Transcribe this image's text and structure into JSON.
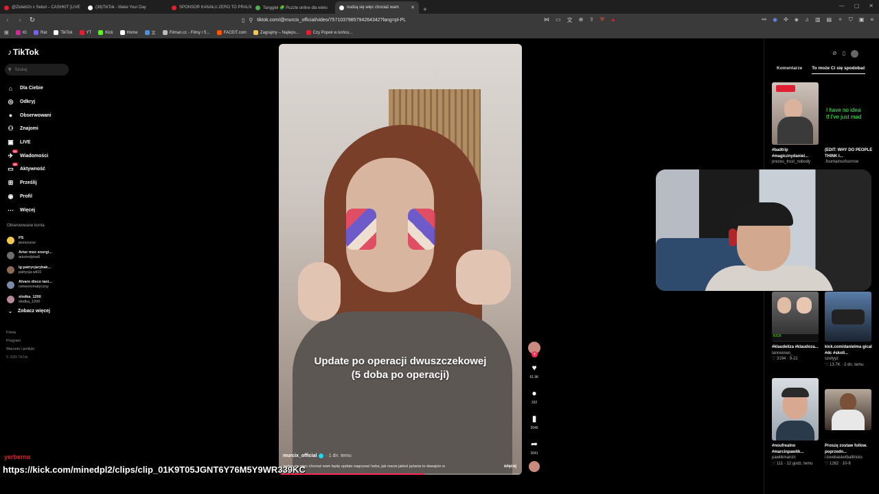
{
  "browser": {
    "tabs": [
      {
        "title": "@Zioleb2n x Sebol – CASHKIT [LIVE",
        "color": "#e02030",
        "active": false
      },
      {
        "title": "(38)TikTok - Make Your Day",
        "color": "#ffffff",
        "active": false
      },
      {
        "title": "SPONSOR KANAŁU ZERO TO PRALN",
        "color": "#e02030",
        "active": false
      },
      {
        "title": "Tangglel 🧩 Puzzle online dla wielu",
        "color": "#4caf50",
        "active": false
      },
      {
        "title": "nudzą się więc chociaż wam",
        "color": "#ffffff",
        "active": true
      }
    ],
    "new_tab": "+",
    "url": "tiktok.com/@murcix_official/video/7571037985794264342?lang=pl-PL",
    "bookmarks": [
      {
        "label": "IG",
        "color": "#d6249f"
      },
      {
        "label": "Rat",
        "color": "#7b5cff"
      },
      {
        "label": "TikTok",
        "color": "#ffffff"
      },
      {
        "label": "YT",
        "color": "#e02030"
      },
      {
        "label": "Kick",
        "color": "#53fc18"
      },
      {
        "label": "Home",
        "color": "#ffffff"
      },
      {
        "label": "文",
        "color": "#4a90e2"
      },
      {
        "label": "Filman.cc - Filmy i S...",
        "color": "#bbbbbb"
      },
      {
        "label": "FACEIT.com",
        "color": "#ff5500"
      },
      {
        "label": "Zagrajmy – Najleps...",
        "color": "#f2c94c"
      },
      {
        "label": "Czy Popek w końcu...",
        "color": "#e02030"
      }
    ]
  },
  "tiktok": {
    "logo": "TikTok",
    "search_placeholder": "Szukaj",
    "nav": [
      {
        "label": "Dla Ciebie",
        "icon": "home-icon",
        "glyph": "⌂"
      },
      {
        "label": "Odkryj",
        "icon": "compass-icon",
        "glyph": "◎"
      },
      {
        "label": "Obserwowani",
        "icon": "avatar-icon",
        "glyph": "●"
      },
      {
        "label": "Znajomi",
        "icon": "friends-icon",
        "glyph": "⚇"
      },
      {
        "label": "LIVE",
        "icon": "live-icon",
        "glyph": "▣"
      },
      {
        "label": "Wiadomości",
        "icon": "messages-icon",
        "glyph": "✈",
        "badge": "34"
      },
      {
        "label": "Aktywność",
        "icon": "activity-icon",
        "glyph": "▭",
        "badge": "10"
      },
      {
        "label": "Prześlij",
        "icon": "upload-icon",
        "glyph": "⊞"
      },
      {
        "label": "Profil",
        "icon": "profile-icon",
        "glyph": "◉"
      },
      {
        "label": "Więcej",
        "icon": "more-icon",
        "glyph": "⋯"
      }
    ],
    "followed_title": "Obserwowane konta",
    "followed": [
      {
        "name": "PS",
        "handle": "pszszszsz",
        "color": "#f2c94c"
      },
      {
        "name": "Artur moc energi...",
        "handle": "arturindykai6",
        "color": "#6d6d6d"
      },
      {
        "name": "ig:patrycjarybak...",
        "handle": "patrycja.wil10",
        "color": "#8a6a5a"
      },
      {
        "name": "Alvaro disco tani...",
        "handle": "romeoromatyczny",
        "color": "#7a8aa8"
      },
      {
        "name": "slodka_1200",
        "handle": "slodka_1200",
        "color": "#b98a9a"
      }
    ],
    "see_more": "Zobacz więcej",
    "footer": [
      "Firma",
      "Program",
      "Warunki i polityki"
    ],
    "copyright": "© 2025 TikTok"
  },
  "video": {
    "caption_line1": "Update po operacji dwuszczekowej",
    "caption_line2": "(5 doba po operacji)",
    "author": "murcix_official",
    "time": "· 1 dn. temu",
    "description": "nudzą się więc chociaż wam będę update nagrywać haha, jak macie jakieś pytania to dawajcie w",
    "more": "więcej",
    "progress": 0.6,
    "likes": "61.9K",
    "comments": "332",
    "saves": "2646",
    "shares": "3041"
  },
  "right_panel": {
    "tabs": [
      "Komentarze",
      "To może Ci się spodobać"
    ],
    "active_tab": 1,
    "cards": [
      {
        "title": "#badtrip #magicznydaniel...",
        "author": "prezes_trust_nobody",
        "stats": ""
      },
      {
        "title": "(EDIT: WHY DO PEOPLE THINK I...",
        "author": ".fountainsofsorrow",
        "stats": ""
      },
      {
        "title": "#klaudeliza #klaudoza...",
        "author": "lanneiowo_",
        "stats": "♡ 3194 · 9-22"
      },
      {
        "title": "kick.com/danielma gical #dc #skoll...",
        "author": "szotyyz",
        "stats": "♡ 13.7K · 2 dn. temu"
      },
      {
        "title": "#noufrealno #marcinpawlik...",
        "author": "pawlikmarcin",
        "stats": "♡ 111 · 12 godz. temu"
      },
      {
        "title": "Proszę zostaw follow. poprzedn...",
        "author": "i.lovebasketballtricks",
        "stats": "♡ 1262 · 10-9"
      }
    ],
    "thumb_text": "I have no idea\ntf I've just mad"
  },
  "overlay": {
    "user": "yerberno",
    "clip_url": "https://kick.com/minedpl2/clips/clip_01K9T05JGNT6Y76M5Y9WR339KC"
  }
}
